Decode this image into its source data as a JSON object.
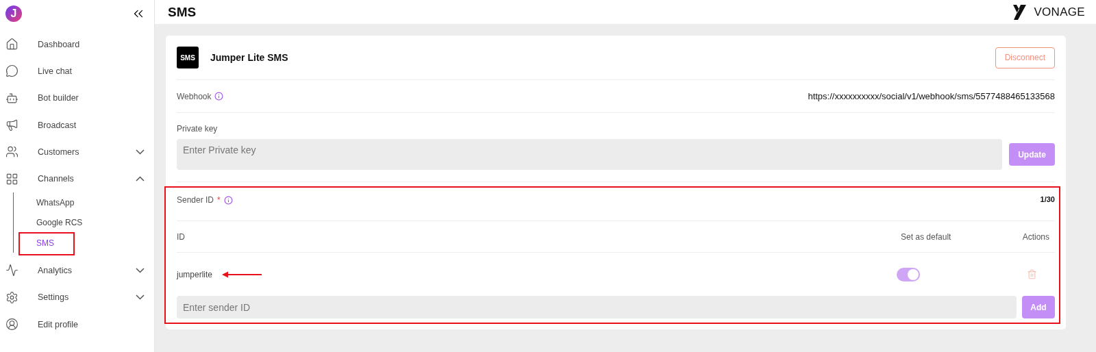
{
  "sidebar": {
    "logo_letter": "J",
    "items": [
      {
        "label": "Dashboard"
      },
      {
        "label": "Live chat"
      },
      {
        "label": "Bot builder"
      },
      {
        "label": "Broadcast"
      },
      {
        "label": "Customers",
        "expanded": false
      },
      {
        "label": "Channels",
        "expanded": true,
        "children": [
          {
            "label": "WhatsApp",
            "selected": false,
            "highlighted": false
          },
          {
            "label": "Google RCS",
            "selected": false,
            "highlighted": false
          },
          {
            "label": "SMS",
            "selected": true,
            "highlighted": true
          }
        ]
      },
      {
        "label": "Analytics",
        "expanded": false
      },
      {
        "label": "Settings",
        "expanded": false
      },
      {
        "label": "Edit profile"
      }
    ]
  },
  "header": {
    "title": "SMS",
    "brand": "VONAGE"
  },
  "card": {
    "badge": "SMS",
    "title": "Jumper Lite SMS",
    "disconnect": "Disconnect",
    "webhook": {
      "label": "Webhook",
      "value": "https://xxxxxxxxxx/social/v1/webhook/sms/5577488465133568"
    },
    "private_key": {
      "label": "Private key",
      "placeholder": "Enter Private key",
      "button": "Update"
    },
    "sender": {
      "label": "Sender ID",
      "required": "*",
      "count": "1/30",
      "highlighted": true,
      "columns": [
        "ID",
        "Set as default",
        "Actions"
      ],
      "rows": [
        {
          "id": "jumperlite",
          "default": true,
          "arrow": true
        }
      ],
      "placeholder": "Enter sender ID",
      "button": "Add"
    }
  }
}
